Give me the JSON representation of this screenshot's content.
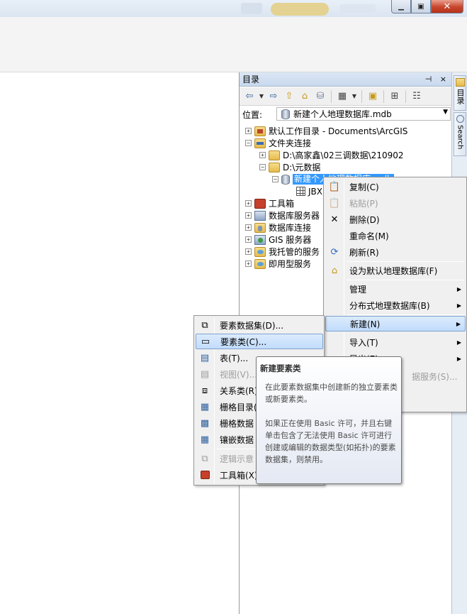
{
  "window": {
    "min_glyph": "▁",
    "max_glyph": "▣",
    "close_glyph": "✕"
  },
  "catalog": {
    "title": "目录",
    "title_buttons": "⊣ ×",
    "location_label": "位置:",
    "location_value": "新建个人地理数据库.mdb",
    "tree": [
      {
        "label": "默认工作目录 - Documents\\ArcGIS",
        "expander": "+"
      },
      {
        "label": "文件夹连接",
        "expander": "−"
      },
      {
        "label": "D:\\高家鑫\\02三调数据\\210902",
        "expander": "+"
      },
      {
        "label": "D:\\元数据",
        "expander": "−"
      },
      {
        "label": "新建个人地理数据库.mdb",
        "expander": "−"
      },
      {
        "label": "JBX"
      },
      {
        "label": "工具箱",
        "expander": "+"
      },
      {
        "label": "数据库服务器",
        "expander": "+"
      },
      {
        "label": "数据库连接",
        "expander": "+"
      },
      {
        "label": "GIS 服务器",
        "expander": "+"
      },
      {
        "label": "我托管的服务",
        "expander": "+"
      },
      {
        "label": "即用型服务",
        "expander": "+"
      }
    ]
  },
  "dock_tabs": [
    {
      "label": "目录"
    },
    {
      "label": "Search"
    }
  ],
  "context_menu": {
    "items": [
      {
        "label": "复制(C)",
        "icon": "copy-icon"
      },
      {
        "label": "粘贴(P)",
        "icon": "paste-icon",
        "disabled": true
      },
      {
        "label": "删除(D)",
        "icon": "delete-icon"
      },
      {
        "label": "重命名(M)"
      },
      {
        "label": "刷新(R)",
        "icon": "refresh-icon"
      },
      {
        "label": "设为默认地理数据库(F)",
        "icon": "default-geodatabase-icon"
      },
      {
        "label": "管理",
        "submenu": true
      },
      {
        "label": "分布式地理数据库(B)",
        "submenu": true
      },
      {
        "label": "新建(N)",
        "submenu": true,
        "highlighted": true
      },
      {
        "label": "导入(T)",
        "submenu": true
      },
      {
        "label": "导出(E)",
        "submenu": true
      },
      {
        "label": "据服务(S)...",
        "disabled": true
      }
    ],
    "arrow_glyph": "▶"
  },
  "submenu": {
    "items": [
      {
        "label": "要素数据集(D)...",
        "icon": "feature-dataset-icon"
      },
      {
        "label": "要素类(C)...",
        "icon": "feature-class-icon",
        "highlighted": true
      },
      {
        "label": "表(T)...",
        "icon": "table-icon"
      },
      {
        "label": "视图(V)...",
        "icon": "view-icon",
        "disabled": true
      },
      {
        "label": "关系类(R)",
        "icon": "relationship-class-icon"
      },
      {
        "label": "栅格目录(",
        "icon": "raster-catalog-icon"
      },
      {
        "label": "栅格数据",
        "icon": "raster-dataset-icon"
      },
      {
        "label": "镶嵌数据",
        "icon": "mosaic-dataset-icon"
      },
      {
        "label": "逻辑示意",
        "icon": "schematic-icon",
        "disabled": true
      },
      {
        "label": "工具箱(X)",
        "icon": "toolbox-icon"
      }
    ]
  },
  "tooltip": {
    "title": "新建要素类",
    "paragraph1": "在此要素数据集中创建新的独立要素类或新要素类。",
    "paragraph2": "如果正在使用 Basic 许可，并且右键单击包含了无法使用 Basic 许可进行创建或编辑的数据类型(如拓扑)的要素数据集，则禁用。"
  }
}
